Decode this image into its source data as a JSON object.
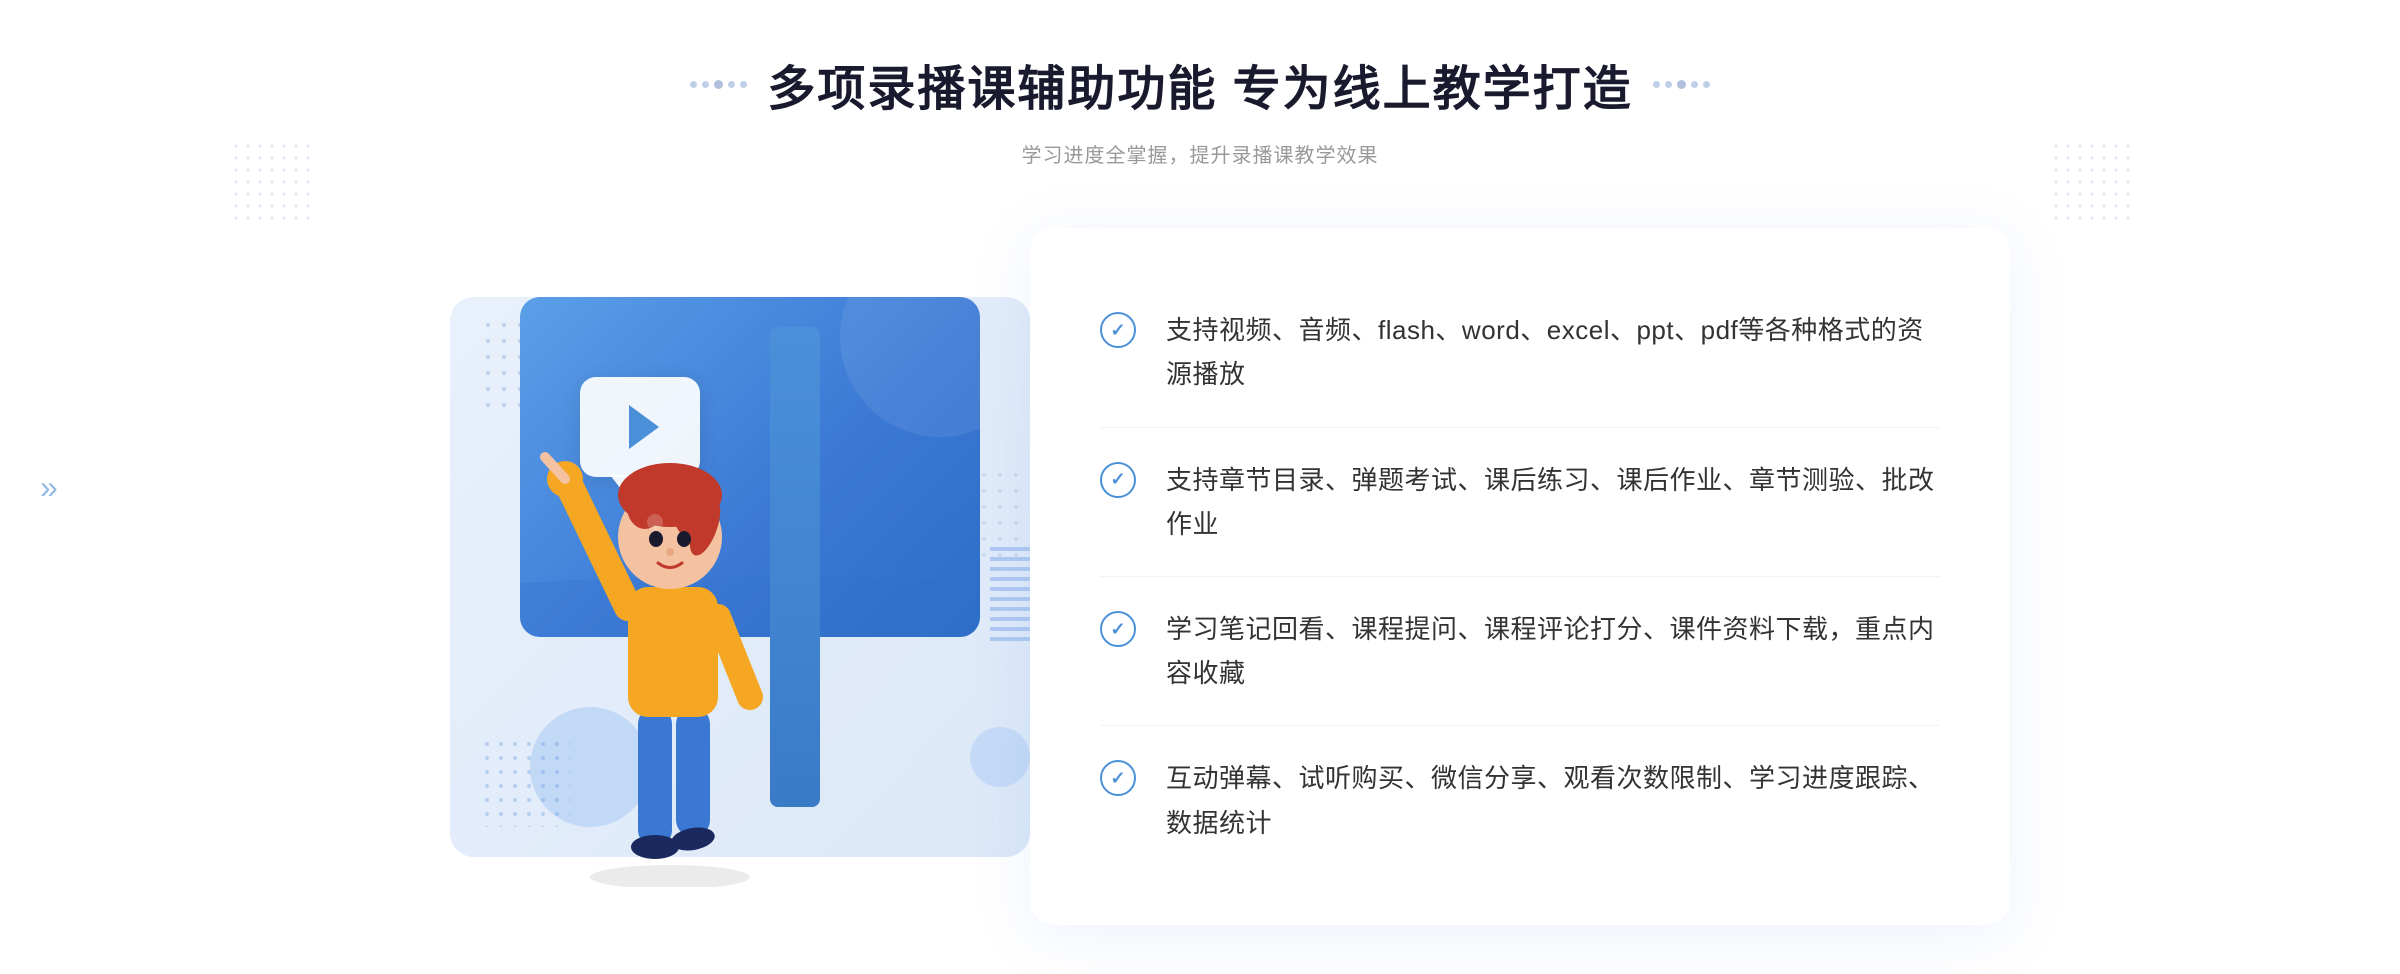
{
  "header": {
    "title": "多项录播课辅助功能 专为线上教学打造",
    "subtitle": "学习进度全掌握，提升录播课教学效果"
  },
  "features": [
    {
      "id": 1,
      "text": "支持视频、音频、flash、word、excel、ppt、pdf等各种格式的资源播放"
    },
    {
      "id": 2,
      "text": "支持章节目录、弹题考试、课后练习、课后作业、章节测验、批改作业"
    },
    {
      "id": 3,
      "text": "学习笔记回看、课程提问、课程评论打分、课件资料下载，重点内容收藏"
    },
    {
      "id": 4,
      "text": "互动弹幕、试听购买、微信分享、观看次数限制、学习进度跟踪、数据统计"
    }
  ],
  "icons": {
    "check": "✓",
    "play": "▶",
    "chevron_right": "»",
    "chevron_left": "«"
  },
  "colors": {
    "primary": "#4a90d9",
    "title": "#1a1a2e",
    "subtitle": "#999999",
    "text": "#333333",
    "border": "#f0f4fa"
  }
}
